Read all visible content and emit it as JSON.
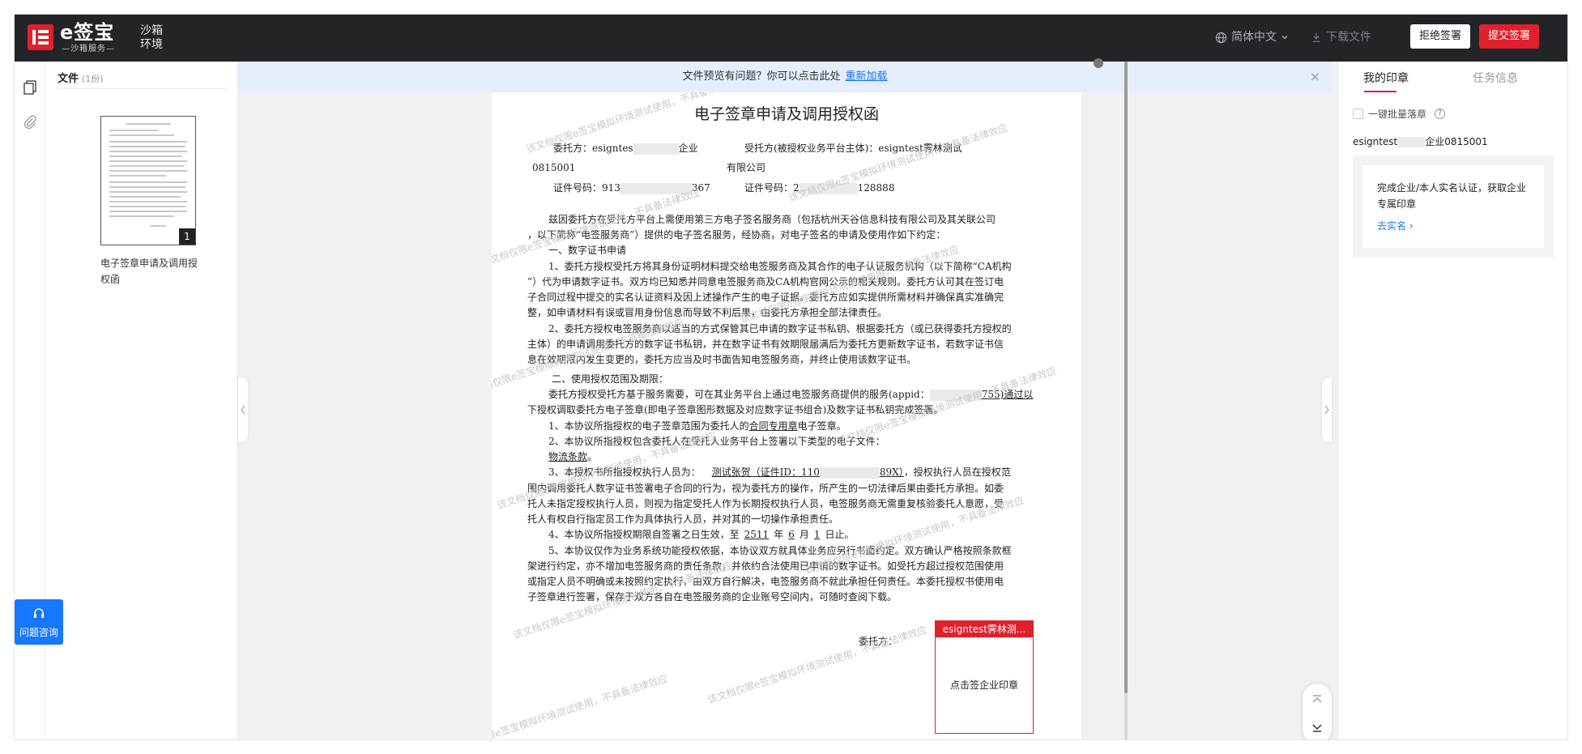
{
  "header": {
    "brand": "e签宝",
    "brand_sub": "—沙箱服务—",
    "env": "沙箱环境",
    "language": "简体中文",
    "download": "下载文件",
    "reject_label": "拒绝签署",
    "submit_label": "提交签署"
  },
  "file_panel": {
    "title": "文件",
    "count": "(1份)",
    "file_name": "电子签章申请及调用授权函",
    "page_number": "1",
    "consult_label": "问题咨询"
  },
  "notice": {
    "text": "文件预览有问题？你可以点击此处",
    "link": "重新加载",
    "close": "×"
  },
  "document": {
    "title": "电子签章申请及调用授权函",
    "p_entrusting": "委托方：esigntes",
    "p_entrusting_tail": "企业",
    "p_entrusted": "受托方(被授权业务平台主体)：esigntest霁林测试",
    "p_0815001": "0815001",
    "p_company": "有限公司",
    "p_cert1": "证件号码：913",
    "p_cert1_tail": "367",
    "p_cert2": "证件号码：2",
    "p_cert2_tail": "128888",
    "l1": "兹因委托方在受托方平台上需使用第三方电子签名服务商（包括杭州天谷信息科技有限公司及其关联公司",
    "l2": "，以下简称“电签服务商”）提供的电子签名服务，经协商，对电子签名的申请及使用作如下约定：",
    "l3": "一、数字证书申请",
    "l4": "1、委托方授权受托方将其身份证明材料提交给电签服务商及其合作的电子认证服务机构（以下简称“CA机构",
    "l5": "”）代为申请数字证书。双方均已知悉并同意电签服务商及CA机构官网公示的相关规则。委托方认可其在签订电",
    "l6": "子合同过程中提交的实名认证资料及因上述操作产生的电子证据。委托方应如实提供所需材料并确保真实准确完",
    "l7": "整，如申请材料有误或冒用身份信息而导致不利后果，由委托方承担全部法律责任。",
    "l8": "2、委托方授权电签服务商以适当的方式保管其已申请的数字证书私钥、根据委托方（或已获得委托方授权的",
    "l9": "主体）的申请调用委托方的数字证书私钥，并在数字证书有效期限届满后为委托方更新数字证书，若数字证书信",
    "l10": "息在效期限内发生变更的，委托方应当及时书面告知电签服务商，并终止使用该数字证书。",
    "l11": "二、使用授权范围及期限：",
    "l12": "委托方授权受托方基于服务需要，可在其业务平台上通过电签服务商提供的服务(appid：",
    "l12_tail": "755)通过以",
    "l13": "下授权调取委托方电子签章(即电子签章图形数据及对应数字证书组合)及数字证书私钥完成签署。",
    "l14": "1、本协议所指授权的电子签章范围为委托人的",
    "l14_u": "合同专用章",
    "l14_tail": "电子签章。",
    "l15": "2、本协议所指授权包含委托人在受托人业务平台上签署以下类型的电子文件：",
    "l16": "物流条款",
    "l16_tail": "。",
    "l17": "3、本授权书所指授权执行人员为：",
    "l17_u": "测试张贺（证件ID：110",
    "l17_u2": "89X）",
    "l17_tail": "，授权执行人员在授权范",
    "l18": "围内调用委托人数字证书签署电子合同的行为，视为委托方的操作，所产生的一切法律后果由委托方承担。如委",
    "l19": "托人未指定授权执行人员，则视为指定受托人作为长期授权执行人员，电签服务商无需重复核验委托人意愿，受",
    "l20": "托人有权自行指定员工作为具体执行人员，并对其的一切操作承担责任。",
    "l21": "4、本协议所指授权期限自签署之日生效，至",
    "l21_y": "2511",
    "l21_m": "6",
    "l21_d": "1",
    "l21_tail_y": "年",
    "l21_tail_m": "月",
    "l21_tail_d": "日止。",
    "l22": "5、本协议仅作为业务系统功能授权依据，本协议双方就具体业务应另行书面约定。双方确认严格按照条款框",
    "l23": "架进行约定，亦不增加电签服务商的责任条款，并依约合法使用已申请的数字证书。如受托方超过授权范围使用",
    "l24": "或指定人员不明确或未按照约定执行，由双方自行解决，电签服务商不就此承担任何责任。本委托授权书使用电",
    "l25": "子签章进行签署，保存于双方各自在电签服务商的企业账号空间内，可随时查阅下载。",
    "l26": "委托方：",
    "watermark": "该文档仅限e签宝模拟环境测试使用，不具备法律效应"
  },
  "sign_box": {
    "header": "esigntest霁林测...",
    "action": "点击签企业印章"
  },
  "right_panel": {
    "tab_seals": "我的印章",
    "tab_tasks": "任务信息",
    "batch_label": "一键批量落章",
    "company": "esigntest",
    "company_tail": "企业0815001",
    "card_text": "完成企业/本人实名认证，获取企业专属印章",
    "card_link": "去实名 ›"
  }
}
